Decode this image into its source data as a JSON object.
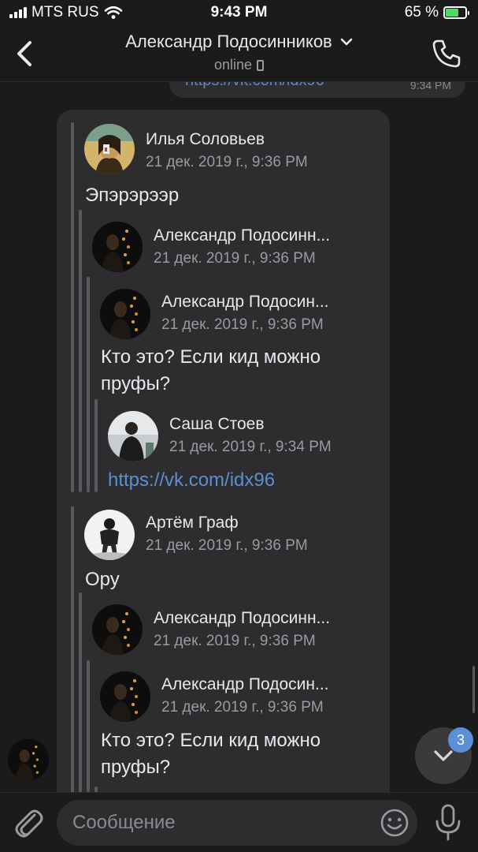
{
  "status_bar": {
    "carrier": "MTS RUS",
    "time": "9:43 PM",
    "battery": "65 %",
    "battery_level": 0.65
  },
  "header": {
    "title": "Александр Подосинников",
    "status": "online",
    "icons": [
      "back-chevron-icon",
      "chevron-down-icon",
      "phone-device-icon",
      "call-icon"
    ]
  },
  "previous_message": {
    "text": "https://vk.com/idx96",
    "time": "9:34 PM"
  },
  "forwarded": [
    {
      "author": "Илья Соловьев",
      "date": "21 дек. 2019 г., 9:36 PM",
      "text": "Эпэрэрээр",
      "quote": {
        "author": "Александр Подосинн...",
        "date": "21 дек. 2019 г., 9:36 PM",
        "quote": {
          "author": "Александр Подосин...",
          "date": "21 дек. 2019 г., 9:36 PM",
          "text": "Кто это? Если кид можно пруфы?",
          "quote": {
            "author": "Саша Стоев",
            "date": "21 дек. 2019 г., 9:34 PM",
            "link": "https://vk.com/idx96"
          }
        }
      }
    },
    {
      "author": "Артём Граф",
      "date": "21 дек. 2019 г., 9:36 PM",
      "text": "Ору",
      "quote": {
        "author": "Александр Подосинн...",
        "date": "21 дек. 2019 г., 9:36 PM",
        "quote": {
          "author": "Александр Подосин...",
          "date": "21 дек. 2019 г., 9:36 PM",
          "text": "Кто это? Если кид можно пруфы?"
        }
      }
    }
  ],
  "scroll_down": {
    "unread_count": "3"
  },
  "composer": {
    "placeholder": "Сообщение",
    "icons": [
      "paperclip-icon",
      "emoji-icon",
      "microphone-icon"
    ]
  },
  "colors": {
    "background": "#1b1b1c",
    "bubble": "#2d2d2f",
    "link": "#5d8fd0",
    "badge": "#5b8fd8",
    "battery_fill": "#4cd964"
  }
}
